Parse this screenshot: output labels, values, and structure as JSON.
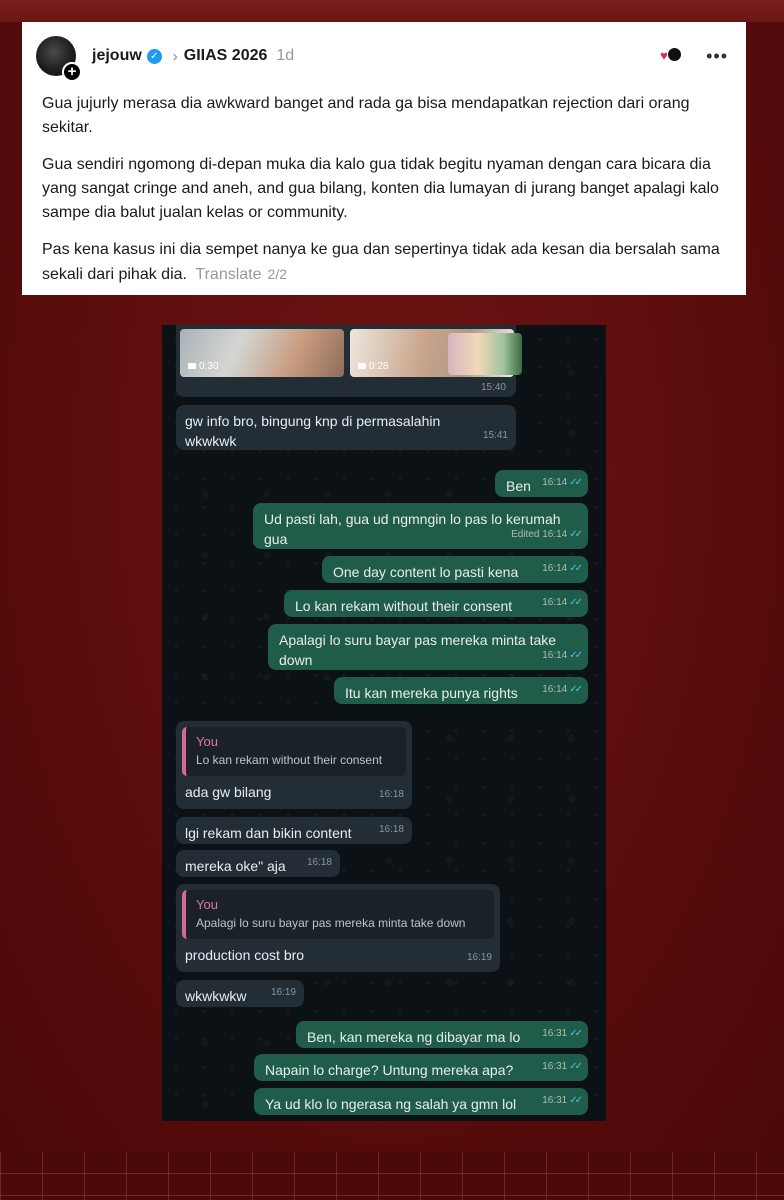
{
  "post": {
    "username": "jejouw",
    "topic": "GIIAS 2026",
    "age": "1d",
    "paragraphs": [
      "Gua jujurly merasa dia awkward banget and rada ga bisa mendapatkan rejection dari orang sekitar.",
      "Gua sendiri ngomong di-depan muka dia kalo gua tidak begitu nyaman dengan cara bicara dia yang sangat cringe and aneh, and gua bilang, konten dia lumayan di jurang banget apalagi kalo sampe dia balut jualan kelas or community.",
      "Pas kena kasus ini dia sempet nanya ke gua dan sepertinya tidak ada kesan dia bersalah sama sekali dari pihak dia."
    ],
    "translate_label": "Translate",
    "pager": "2/2"
  },
  "chat": {
    "media": {
      "dur1": "0:30",
      "dur2": "0:28",
      "time": "15:40"
    },
    "messages": [
      {
        "text": "gw info bro, bingung knp di permasalahin wkwkwk",
        "time": "15:41"
      },
      {
        "text": "Ben",
        "time": "16:14"
      },
      {
        "text": "Ud pasti lah, gua ud ngmngin lo pas lo kerumah gua",
        "time": "Edited 16:14"
      },
      {
        "text": "One day content lo pasti kena",
        "time": "16:14"
      },
      {
        "text": "Lo kan rekam without their consent",
        "time": "16:14"
      },
      {
        "text": "Apalagi lo suru bayar pas mereka minta take down",
        "time": "16:14"
      },
      {
        "text": "Itu kan mereka punya rights",
        "time": "16:14"
      },
      {
        "quote_author": "You",
        "quote_text": "Lo kan rekam without their consent",
        "text": "ada gw bilang",
        "time": "16:18"
      },
      {
        "text": "lgi rekam dan bikin content",
        "time": "16:18"
      },
      {
        "text": "mereka oke\" aja",
        "time": "16:18"
      },
      {
        "quote_author": "You",
        "quote_text": "Apalagi lo suru bayar pas mereka minta take down",
        "text": "production cost bro",
        "time": "16:19"
      },
      {
        "text": "wkwkwkw",
        "time": "16:19"
      },
      {
        "text": "Ben, kan mereka ng dibayar ma lo",
        "time": "16:31"
      },
      {
        "text": "Napain lo charge? Untung mereka apa?",
        "time": "16:31"
      },
      {
        "text": "Ya ud klo lo ngerasa ng salah ya gmn lol",
        "time": "16:31"
      }
    ]
  },
  "colors": {
    "background": "#5e0d0d",
    "incoming_bubble": "#232d36",
    "outgoing_bubble": "#1f5c4a",
    "read_ticks": "#53bdeb",
    "quote_accent": "#d56a8d",
    "verified": "#1d9bf0"
  },
  "icons": [
    "avatar-plus-icon",
    "verified-badge-icon",
    "chevron-right-icon",
    "reaction-avatars-icon",
    "more-options-icon",
    "video-camera-icon",
    "double-check-icon"
  ]
}
